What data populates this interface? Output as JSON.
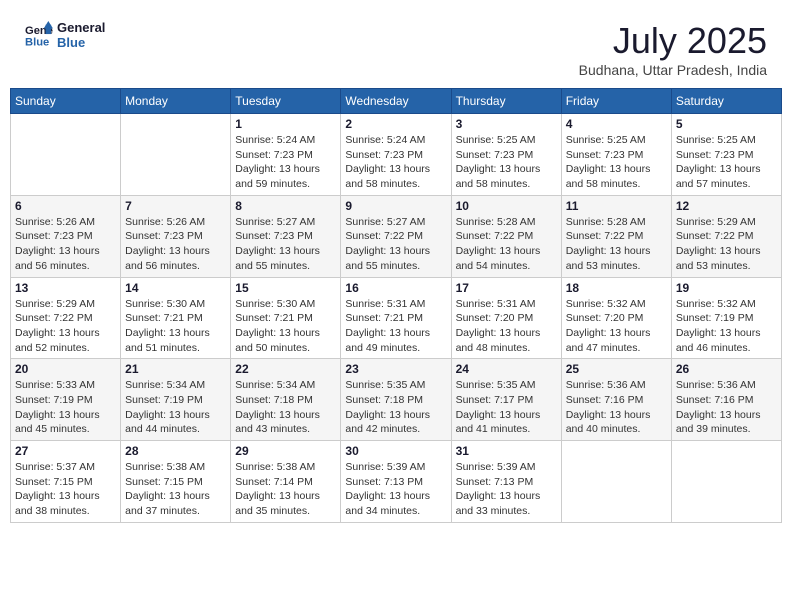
{
  "header": {
    "logo_line1": "General",
    "logo_line2": "Blue",
    "month_year": "July 2025",
    "location": "Budhana, Uttar Pradesh, India"
  },
  "days_of_week": [
    "Sunday",
    "Monday",
    "Tuesday",
    "Wednesday",
    "Thursday",
    "Friday",
    "Saturday"
  ],
  "weeks": [
    [
      {
        "day": "",
        "info": ""
      },
      {
        "day": "",
        "info": ""
      },
      {
        "day": "1",
        "info": "Sunrise: 5:24 AM\nSunset: 7:23 PM\nDaylight: 13 hours and 59 minutes."
      },
      {
        "day": "2",
        "info": "Sunrise: 5:24 AM\nSunset: 7:23 PM\nDaylight: 13 hours and 58 minutes."
      },
      {
        "day": "3",
        "info": "Sunrise: 5:25 AM\nSunset: 7:23 PM\nDaylight: 13 hours and 58 minutes."
      },
      {
        "day": "4",
        "info": "Sunrise: 5:25 AM\nSunset: 7:23 PM\nDaylight: 13 hours and 58 minutes."
      },
      {
        "day": "5",
        "info": "Sunrise: 5:25 AM\nSunset: 7:23 PM\nDaylight: 13 hours and 57 minutes."
      }
    ],
    [
      {
        "day": "6",
        "info": "Sunrise: 5:26 AM\nSunset: 7:23 PM\nDaylight: 13 hours and 56 minutes."
      },
      {
        "day": "7",
        "info": "Sunrise: 5:26 AM\nSunset: 7:23 PM\nDaylight: 13 hours and 56 minutes."
      },
      {
        "day": "8",
        "info": "Sunrise: 5:27 AM\nSunset: 7:23 PM\nDaylight: 13 hours and 55 minutes."
      },
      {
        "day": "9",
        "info": "Sunrise: 5:27 AM\nSunset: 7:22 PM\nDaylight: 13 hours and 55 minutes."
      },
      {
        "day": "10",
        "info": "Sunrise: 5:28 AM\nSunset: 7:22 PM\nDaylight: 13 hours and 54 minutes."
      },
      {
        "day": "11",
        "info": "Sunrise: 5:28 AM\nSunset: 7:22 PM\nDaylight: 13 hours and 53 minutes."
      },
      {
        "day": "12",
        "info": "Sunrise: 5:29 AM\nSunset: 7:22 PM\nDaylight: 13 hours and 53 minutes."
      }
    ],
    [
      {
        "day": "13",
        "info": "Sunrise: 5:29 AM\nSunset: 7:22 PM\nDaylight: 13 hours and 52 minutes."
      },
      {
        "day": "14",
        "info": "Sunrise: 5:30 AM\nSunset: 7:21 PM\nDaylight: 13 hours and 51 minutes."
      },
      {
        "day": "15",
        "info": "Sunrise: 5:30 AM\nSunset: 7:21 PM\nDaylight: 13 hours and 50 minutes."
      },
      {
        "day": "16",
        "info": "Sunrise: 5:31 AM\nSunset: 7:21 PM\nDaylight: 13 hours and 49 minutes."
      },
      {
        "day": "17",
        "info": "Sunrise: 5:31 AM\nSunset: 7:20 PM\nDaylight: 13 hours and 48 minutes."
      },
      {
        "day": "18",
        "info": "Sunrise: 5:32 AM\nSunset: 7:20 PM\nDaylight: 13 hours and 47 minutes."
      },
      {
        "day": "19",
        "info": "Sunrise: 5:32 AM\nSunset: 7:19 PM\nDaylight: 13 hours and 46 minutes."
      }
    ],
    [
      {
        "day": "20",
        "info": "Sunrise: 5:33 AM\nSunset: 7:19 PM\nDaylight: 13 hours and 45 minutes."
      },
      {
        "day": "21",
        "info": "Sunrise: 5:34 AM\nSunset: 7:19 PM\nDaylight: 13 hours and 44 minutes."
      },
      {
        "day": "22",
        "info": "Sunrise: 5:34 AM\nSunset: 7:18 PM\nDaylight: 13 hours and 43 minutes."
      },
      {
        "day": "23",
        "info": "Sunrise: 5:35 AM\nSunset: 7:18 PM\nDaylight: 13 hours and 42 minutes."
      },
      {
        "day": "24",
        "info": "Sunrise: 5:35 AM\nSunset: 7:17 PM\nDaylight: 13 hours and 41 minutes."
      },
      {
        "day": "25",
        "info": "Sunrise: 5:36 AM\nSunset: 7:16 PM\nDaylight: 13 hours and 40 minutes."
      },
      {
        "day": "26",
        "info": "Sunrise: 5:36 AM\nSunset: 7:16 PM\nDaylight: 13 hours and 39 minutes."
      }
    ],
    [
      {
        "day": "27",
        "info": "Sunrise: 5:37 AM\nSunset: 7:15 PM\nDaylight: 13 hours and 38 minutes."
      },
      {
        "day": "28",
        "info": "Sunrise: 5:38 AM\nSunset: 7:15 PM\nDaylight: 13 hours and 37 minutes."
      },
      {
        "day": "29",
        "info": "Sunrise: 5:38 AM\nSunset: 7:14 PM\nDaylight: 13 hours and 35 minutes."
      },
      {
        "day": "30",
        "info": "Sunrise: 5:39 AM\nSunset: 7:13 PM\nDaylight: 13 hours and 34 minutes."
      },
      {
        "day": "31",
        "info": "Sunrise: 5:39 AM\nSunset: 7:13 PM\nDaylight: 13 hours and 33 minutes."
      },
      {
        "day": "",
        "info": ""
      },
      {
        "day": "",
        "info": ""
      }
    ]
  ]
}
